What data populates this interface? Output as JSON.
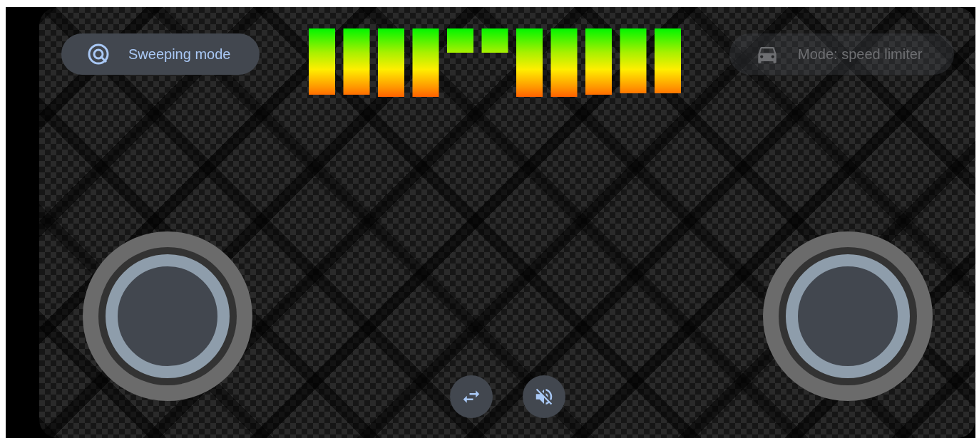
{
  "mode_buttons": [
    {
      "label": "Sweeping mode",
      "disabled": false
    },
    {
      "label": "Mode: speed limiter",
      "disabled": true
    }
  ]
}
